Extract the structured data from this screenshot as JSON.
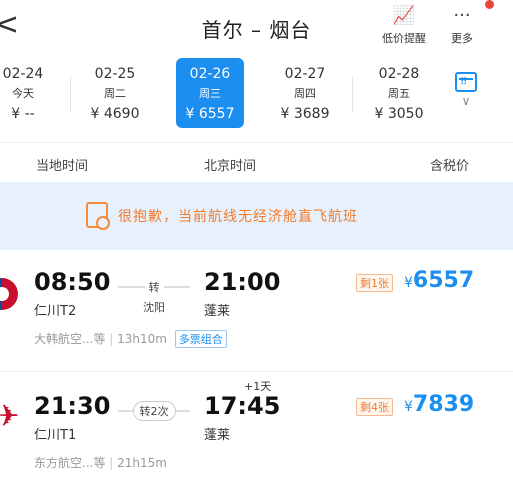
{
  "header": {
    "back": "<",
    "route": "首尔 – 烟台",
    "price_alert_label": "低价提醒",
    "more_label": "更多"
  },
  "dates": [
    {
      "date": "02-24",
      "weekday": "今天",
      "price": "¥ --"
    },
    {
      "date": "02-25",
      "weekday": "周二",
      "price": "¥ 4690"
    },
    {
      "date": "02-26",
      "weekday": "周三",
      "price": "¥ 6557",
      "selected": true
    },
    {
      "date": "02-27",
      "weekday": "周四",
      "price": "¥ 3689"
    },
    {
      "date": "02-28",
      "weekday": "周五",
      "price": "¥ 3050"
    }
  ],
  "columns": {
    "local_time": "当地时间",
    "beijing_time": "北京时间",
    "tax_included": "含税价"
  },
  "notice": {
    "text": "很抱歉，当前航线无经济舱直飞航班"
  },
  "flights": [
    {
      "dep_time": "08:50",
      "dep_airport": "仁川T2",
      "transfer": "转",
      "via": "沈阳",
      "arr_time": "21:00",
      "arr_airport": "蓬莱",
      "plus_day": "",
      "remaining": "剩1张",
      "currency": "¥",
      "price": "6557",
      "airline": "大韩航空...等",
      "duration": "13h10m",
      "tag": "多票组合"
    },
    {
      "dep_time": "21:30",
      "dep_airport": "仁川T1",
      "transfer": "转2次",
      "via": "",
      "arr_time": "17:45",
      "arr_airport": "蓬莱",
      "plus_day": "+1天",
      "remaining": "剩4张",
      "currency": "¥",
      "price": "7839",
      "airline": "东方航空...等",
      "duration": "21h15m",
      "tag": ""
    }
  ]
}
